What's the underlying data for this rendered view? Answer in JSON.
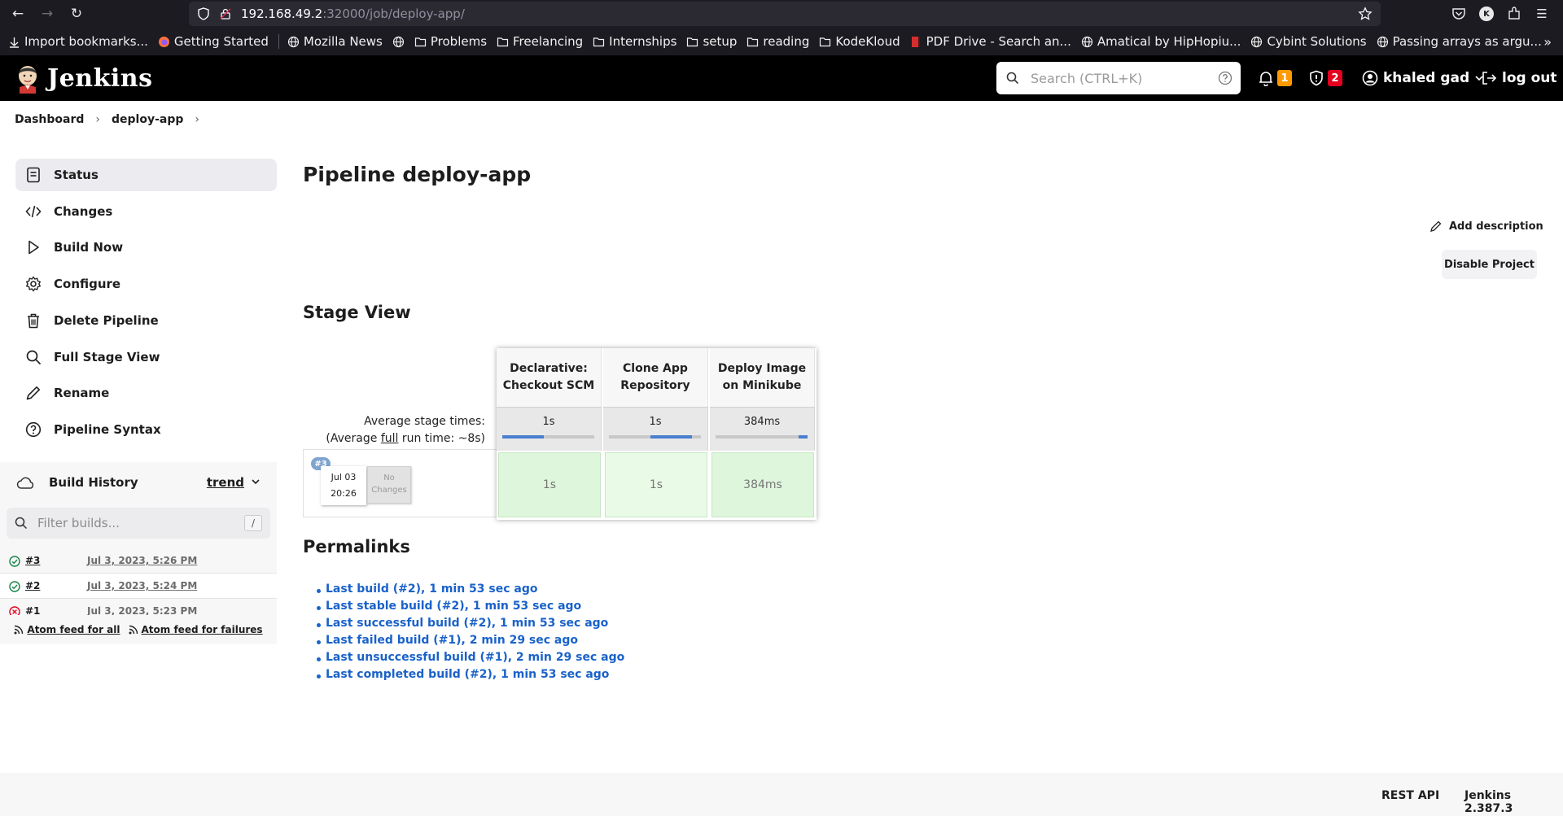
{
  "browser": {
    "url_host": "192.168.49.2",
    "url_path": ":32000/job/deploy-app/",
    "profile_initial": "K"
  },
  "bookmarks": [
    {
      "label": "Import bookmarks...",
      "icon": "import-icon"
    },
    {
      "label": "Getting Started",
      "icon": "firefox-icon"
    },
    {
      "label": "Mozilla News",
      "icon": "globe-icon"
    },
    {
      "label": "",
      "icon": "globe-icon"
    },
    {
      "label": "Problems",
      "icon": "folder-icon"
    },
    {
      "label": "Freelancing",
      "icon": "folder-icon"
    },
    {
      "label": "Internships",
      "icon": "folder-icon"
    },
    {
      "label": "setup",
      "icon": "folder-icon"
    },
    {
      "label": "reading",
      "icon": "folder-icon"
    },
    {
      "label": "KodeKloud",
      "icon": "folder-icon"
    },
    {
      "label": "PDF Drive - Search an...",
      "icon": "pdfdrive-icon"
    },
    {
      "label": "Amatical by HipHopiu...",
      "icon": "globe-icon"
    },
    {
      "label": "Cybint Solutions",
      "icon": "globe-icon"
    },
    {
      "label": "Passing arrays as argu...",
      "icon": "globe-icon"
    }
  ],
  "header": {
    "logo_text": "Jenkins",
    "search_placeholder": "Search (CTRL+K)",
    "notifications_count": "1",
    "security_count": "2",
    "user": "khaled gad",
    "logout": "log out",
    "colors": {
      "notification_badge": "#fe9a00",
      "security_badge": "#e6001f"
    }
  },
  "breadcrumb": [
    "Dashboard",
    "deploy-app"
  ],
  "sidebar": {
    "items": [
      {
        "label": "Status",
        "icon": "notepad-icon",
        "active": true
      },
      {
        "label": "Changes",
        "icon": "code-icon"
      },
      {
        "label": "Build Now",
        "icon": "play-icon"
      },
      {
        "label": "Configure",
        "icon": "gear-icon"
      },
      {
        "label": "Delete Pipeline",
        "icon": "trash-icon"
      },
      {
        "label": "Full Stage View",
        "icon": "search-icon"
      },
      {
        "label": "Rename",
        "icon": "pencil-icon"
      },
      {
        "label": "Pipeline Syntax",
        "icon": "help-icon"
      }
    ]
  },
  "build_history": {
    "title": "Build History",
    "trend": "trend",
    "filter_placeholder": "Filter builds...",
    "filter_shortcut": "/",
    "builds": [
      {
        "number": "#3",
        "date": "Jul 3, 2023, 5:26 PM",
        "status": "success"
      },
      {
        "number": "#2",
        "date": "Jul 3, 2023, 5:24 PM",
        "status": "success"
      },
      {
        "number": "#1",
        "date": "Jul 3, 2023, 5:23 PM",
        "status": "failed"
      }
    ],
    "feed_all": "Atom feed for all",
    "feed_failures": "Atom feed for failures"
  },
  "main": {
    "title": "Pipeline deploy-app",
    "add_description": "Add description",
    "disable_project": "Disable Project",
    "stage_view_title": "Stage View",
    "avg_stage_times": "Average stage times:",
    "avg_full_prefix": "(Average ",
    "avg_full_link": "full",
    "avg_full_suffix": " run time: ~8s)",
    "stages": [
      {
        "name_line1": "Declarative:",
        "name_line2": "Checkout SCM",
        "avg": "1s",
        "bar_fraction": 0.45,
        "bar_start": 0.0
      },
      {
        "name_line1": "Clone App",
        "name_line2": "Repository",
        "avg": "1s",
        "bar_fraction": 0.45,
        "bar_start": 0.45
      },
      {
        "name_line1": "Deploy Image",
        "name_line2": "on Minikube",
        "avg": "384ms",
        "bar_fraction": 0.1,
        "bar_start": 0.9
      }
    ],
    "run": {
      "badge": "#3",
      "date": "Jul 03",
      "time": "20:26",
      "changes_line1": "No",
      "changes_line2": "Changes",
      "cells": [
        "1s",
        "1s",
        "384ms"
      ]
    },
    "permalinks_title": "Permalinks",
    "permalinks": [
      "Last build (#2), 1 min 53 sec ago",
      "Last stable build (#2), 1 min 53 sec ago",
      "Last successful build (#2), 1 min 53 sec ago",
      "Last failed build (#1), 2 min 29 sec ago",
      "Last unsuccessful build (#1), 2 min 29 sec ago",
      "Last completed build (#2), 1 min 53 sec ago"
    ]
  },
  "footer": {
    "rest_api": "REST API",
    "version": "Jenkins 2.387.3"
  }
}
